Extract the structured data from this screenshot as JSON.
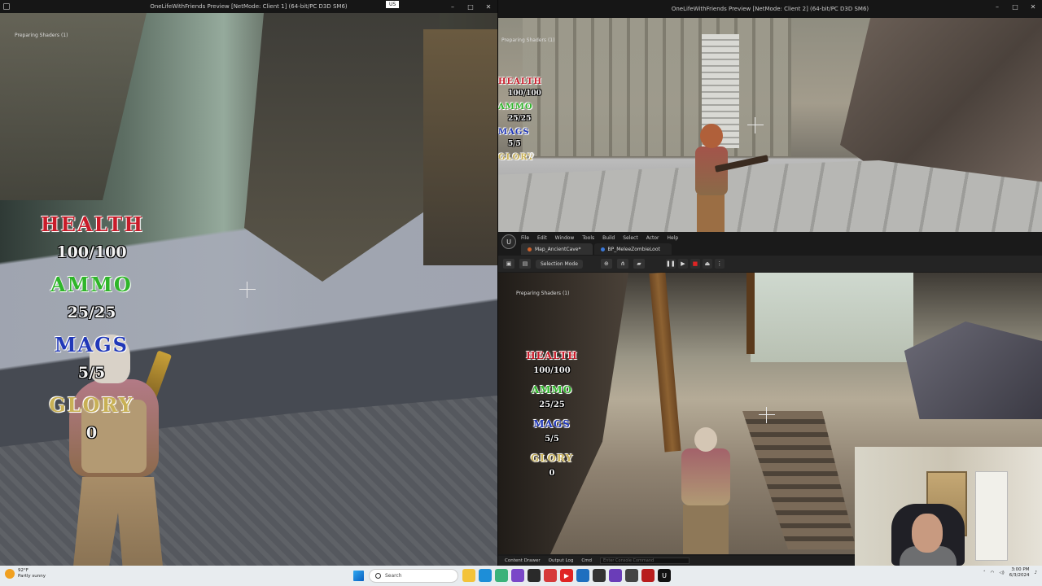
{
  "client1": {
    "title": "OneLifeWithFriends Preview [NetMode: Client 1]  (64-bit/PC D3D SM6)",
    "status": "Preparing Shaders (1)",
    "keyboard": "US",
    "hud": {
      "health_label": "HEALTH",
      "health_value": "100/100",
      "ammo_label": "AMMO",
      "ammo_value": "25/25",
      "mags_label": "MAGS",
      "mags_value": "5/5",
      "glory_label": "GLORY",
      "glory_value": "0"
    }
  },
  "client2": {
    "title": "OneLifeWithFriends Preview [NetMode: Client 2]  (64-bit/PC D3D SM6)",
    "status": "Preparing Shaders (1)",
    "hud": {
      "health_label": "HEALTH",
      "health_value": "100/100",
      "ammo_label": "AMMO",
      "ammo_value": "25/25",
      "mags_label": "MAGS",
      "mags_value": "5/5",
      "glory_label": "GLORY",
      "glory_value": "0"
    }
  },
  "editor": {
    "menu": [
      "File",
      "Edit",
      "Window",
      "Tools",
      "Build",
      "Select",
      "Actor",
      "Help"
    ],
    "tabs": [
      {
        "label": "Map_AncientCave*"
      },
      {
        "label": "BP_MeleeZombieLoot"
      }
    ],
    "toolbar": {
      "mode": "Selection Mode"
    },
    "viewport_status": "Preparing Shaders (1)",
    "hud": {
      "health_label": "HEALTH",
      "health_value": "100/100",
      "ammo_label": "AMMO",
      "ammo_value": "25/25",
      "mags_label": "MAGS",
      "mags_value": "5/5",
      "glory_label": "GLORY",
      "glory_value": "0"
    },
    "bottom": {
      "content_drawer": "Content Drawer",
      "output_log": "Output Log",
      "cmd": "Cmd",
      "console_placeholder": "Enter Console Command"
    }
  },
  "taskbar": {
    "temp": "92°F",
    "weather": "Partly sunny",
    "search_placeholder": "Search",
    "time": "3:00 PM",
    "date": "6/3/2024"
  }
}
